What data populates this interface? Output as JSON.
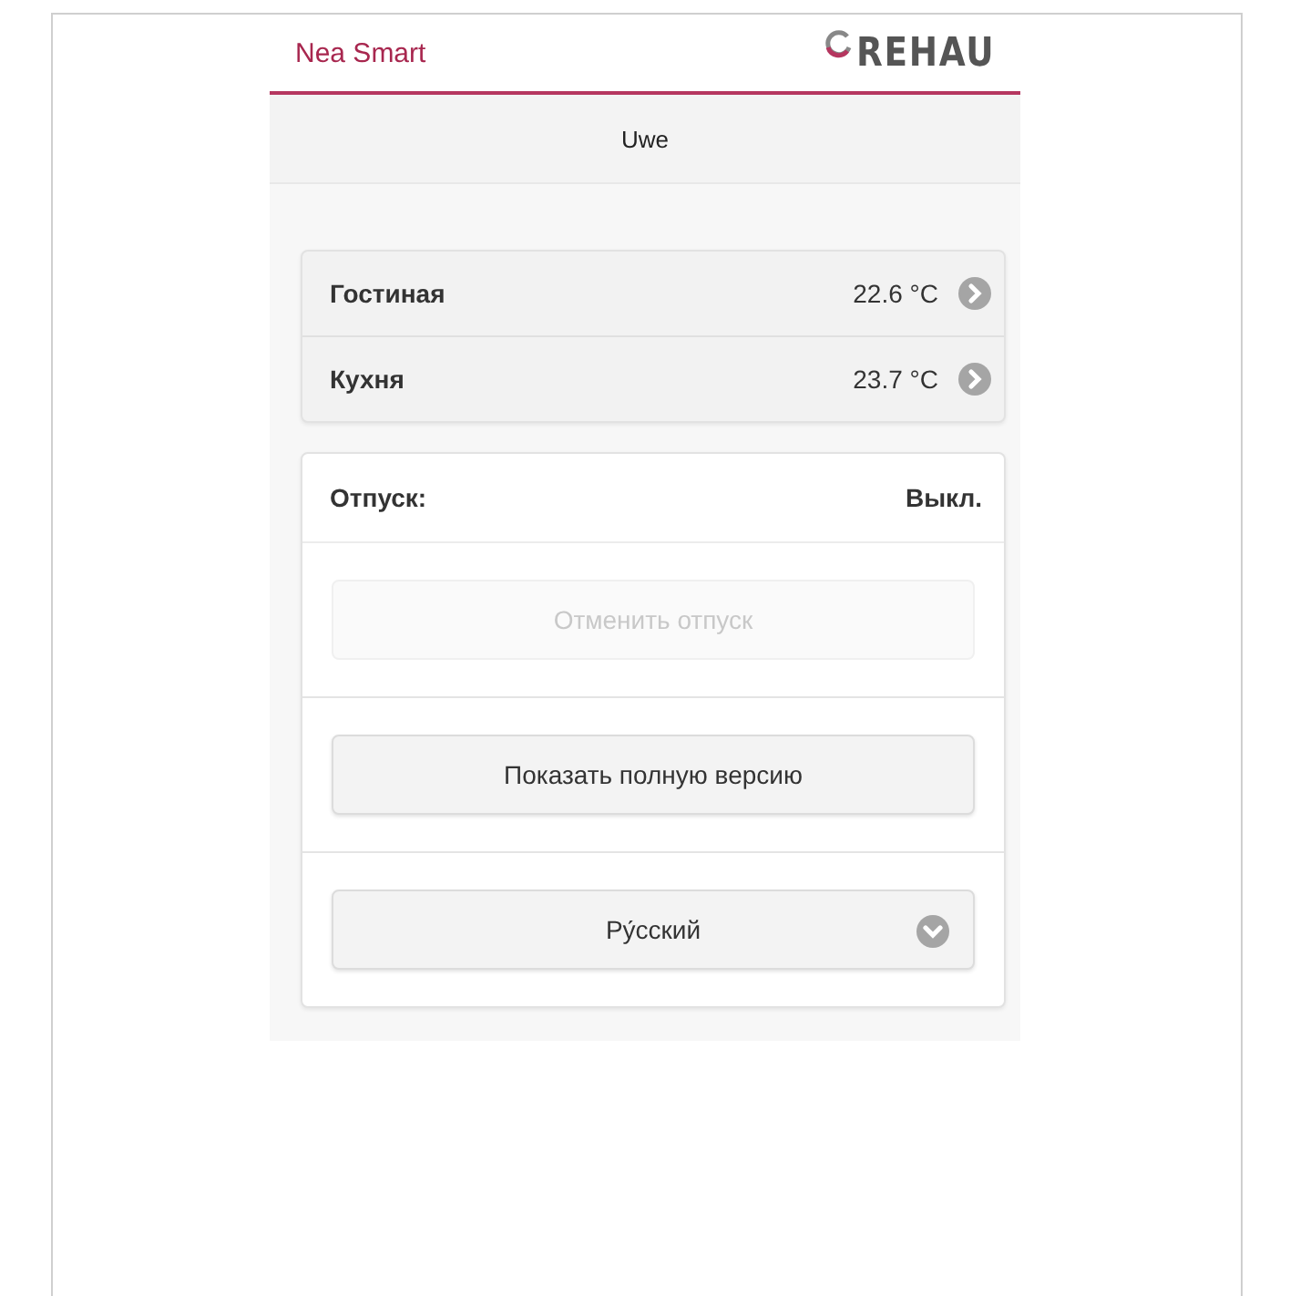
{
  "header": {
    "app_name": "Nea Smart",
    "logo_text": "REHAU"
  },
  "user_bar": {
    "name": "Uwe"
  },
  "rooms": [
    {
      "name": "Гостиная",
      "temperature": "22.6 °C"
    },
    {
      "name": "Кухня",
      "temperature": "23.7 °C"
    }
  ],
  "vacation": {
    "label": "Отпуск:",
    "status": "Выкл.",
    "cancel_button": {
      "label": "Отменить отпуск",
      "disabled": true
    }
  },
  "full_version_button": {
    "label": "Показать полную версию"
  },
  "language_select": {
    "value": "Ру́сский"
  }
}
